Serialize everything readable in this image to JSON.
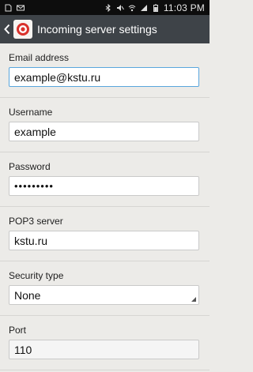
{
  "status_bar": {
    "time": "11:03 PM",
    "icons": [
      "sd-card-icon",
      "mail-icon",
      "bluetooth-icon",
      "mute-icon",
      "wifi-icon",
      "signal-icon",
      "battery-icon"
    ]
  },
  "action_bar": {
    "title": "Incoming server settings",
    "app_icon": "email-app-icon"
  },
  "fields": {
    "email": {
      "label": "Email address",
      "value": "example@kstu.ru"
    },
    "username": {
      "label": "Username",
      "value": "example"
    },
    "password": {
      "label": "Password",
      "value": "•••••••••"
    },
    "pop3": {
      "label": "POP3 server",
      "value": "kstu.ru"
    },
    "security": {
      "label": "Security type",
      "value": "None"
    },
    "port": {
      "label": "Port",
      "value": "110"
    }
  },
  "colors": {
    "action_bar": "#3e4348",
    "status_bar": "#0d0d0d",
    "background": "#ecebe8",
    "focus": "#59a6dd"
  }
}
